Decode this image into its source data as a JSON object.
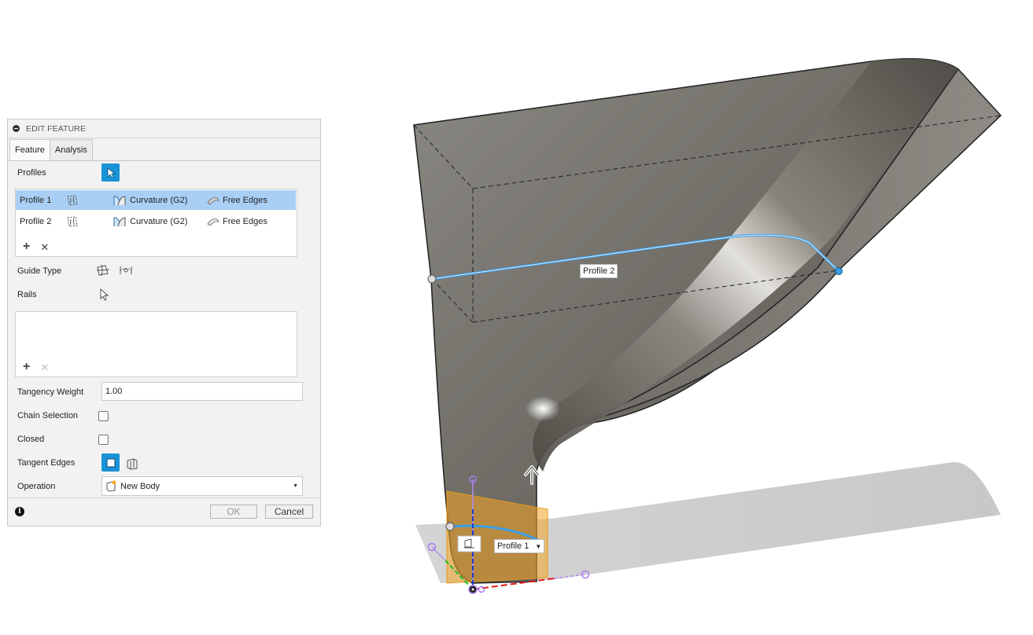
{
  "panel": {
    "title": "EDIT FEATURE",
    "tabs": [
      {
        "label": "Feature",
        "active": true
      },
      {
        "label": "Analysis",
        "active": false
      }
    ],
    "profiles_label": "Profiles",
    "profiles": [
      {
        "name": "Profile 1",
        "continuity": "Curvature (G2)",
        "edges": "Free Edges",
        "selected": true
      },
      {
        "name": "Profile 2",
        "continuity": "Curvature (G2)",
        "edges": "Free Edges",
        "selected": false
      }
    ],
    "guide_type_label": "Guide Type",
    "rails_label": "Rails",
    "tangency_weight_label": "Tangency Weight",
    "tangency_weight_value": "1.00",
    "chain_selection_label": "Chain Selection",
    "chain_selection_checked": false,
    "closed_label": "Closed",
    "closed_checked": false,
    "tangent_edges_label": "Tangent Edges",
    "operation_label": "Operation",
    "operation_value": "New Body",
    "ok_label": "OK",
    "cancel_label": "Cancel"
  },
  "viewport": {
    "profile2_label": "Profile 2",
    "profile1_label": "Profile 1"
  },
  "colors": {
    "accent": "#1a93d6",
    "selected_row": "#a9cff5",
    "profile_curve": "#3a9ee8",
    "gizmo_orange": "#f5a623",
    "gizmo_purple": "#a97cf0"
  },
  "icons": [
    "collapse-icon",
    "select-arrow-icon",
    "profile-icon",
    "curvature-icon",
    "free-edges-icon",
    "guide-type-icon",
    "rails-arrow-icon",
    "tangent-edges-icon",
    "new-body-icon",
    "info-icon",
    "move-arrow-icon"
  ]
}
